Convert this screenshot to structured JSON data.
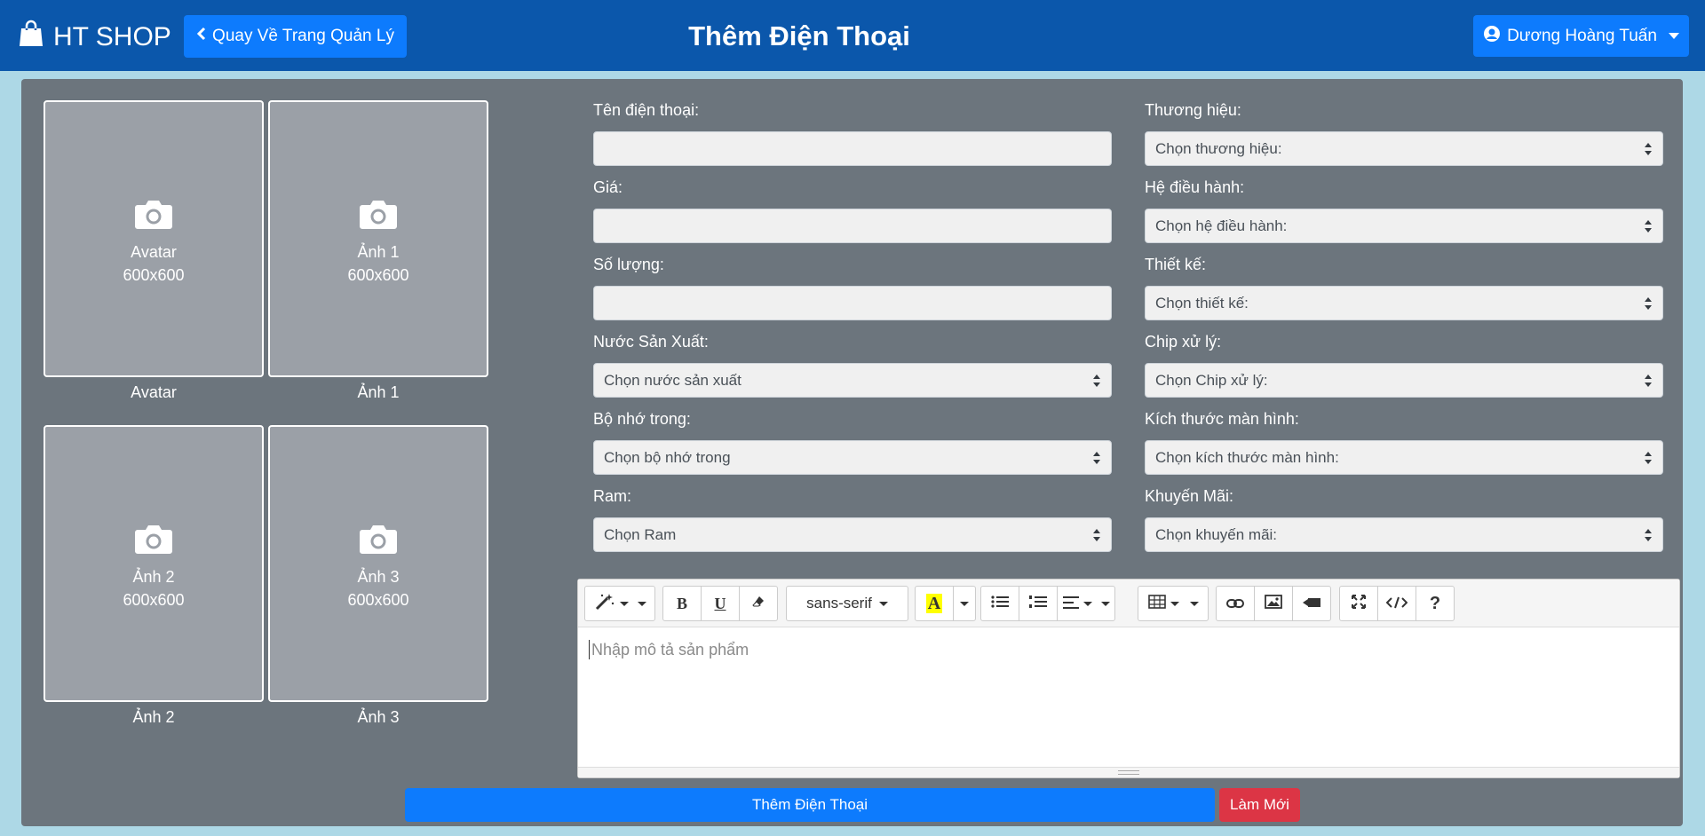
{
  "navbar": {
    "brand": "HT SHOP",
    "back_button": "Quay Về Trang Quản Lý",
    "title": "Thêm Điện Thoại",
    "user": "Dương Hoàng Tuấn"
  },
  "images": [
    {
      "name": "Avatar",
      "size": "600x600",
      "caption": "Avatar"
    },
    {
      "name": "Ảnh 1",
      "size": "600x600",
      "caption": "Ảnh 1"
    },
    {
      "name": "Ảnh 2",
      "size": "600x600",
      "caption": "Ảnh 2"
    },
    {
      "name": "Ảnh 3",
      "size": "600x600",
      "caption": "Ảnh 3"
    }
  ],
  "form": {
    "name_label": "Tên điện thoại:",
    "name_value": "",
    "brand_label": "Thương hiệu:",
    "brand_value": "Chọn thương hiệu:",
    "price_label": "Giá:",
    "price_value": "",
    "os_label": "Hệ điều hành:",
    "os_value": "Chọn hệ điều hành:",
    "quantity_label": "Số lượng:",
    "quantity_value": "",
    "design_label": "Thiết kế:",
    "design_value": "Chọn thiết kế:",
    "country_label": "Nước Sản Xuất:",
    "country_value": "Chọn nước sản xuất",
    "chip_label": "Chip xử lý:",
    "chip_value": "Chọn Chip xử lý:",
    "storage_label": "Bộ nhớ trong:",
    "storage_value": "Chọn bộ nhớ trong",
    "screen_label": "Kích thước màn hình:",
    "screen_value": "Chọn kích thước màn hình:",
    "ram_label": "Ram:",
    "ram_value": "Chọn Ram",
    "promo_label": "Khuyến Mãi:",
    "promo_value": "Chọn khuyến mãi:"
  },
  "editor": {
    "font_family": "sans-serif",
    "bold": "B",
    "underline": "U",
    "color": "A",
    "help": "?",
    "placeholder": "Nhập mô tả sản phẩm"
  },
  "actions": {
    "submit": "Thêm Điện Thoại",
    "reset": "Làm Mới"
  },
  "colors": {
    "navbar": "#0b57ab",
    "primary": "#0d7bfd",
    "danger": "#dc3545",
    "panel": "#6c757d",
    "page_background": "#add8e6"
  }
}
